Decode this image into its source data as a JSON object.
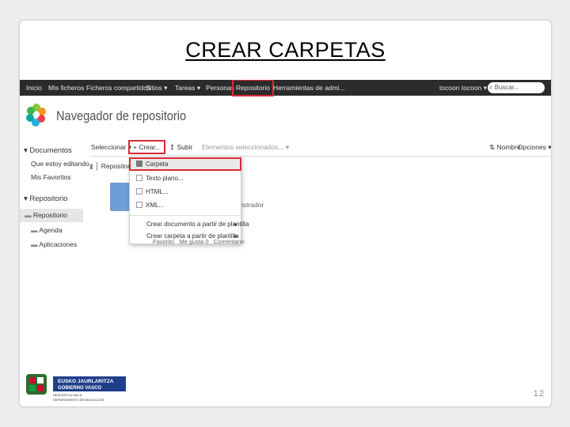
{
  "slide": {
    "title": "CREAR CARPETAS",
    "page_number": "12"
  },
  "topnav": {
    "items": [
      "Inicio",
      "Mis ficheros",
      "Ficheros compartidos",
      "Sitios ▾",
      "Tareas ▾",
      "Personas",
      "Repositorio",
      "Herramientas de admi..."
    ],
    "highlighted": "Repositorio",
    "user": "tocoon tocoon ▾",
    "search_placeholder": "Buscar..."
  },
  "app": {
    "title": "Navegador de repositorio"
  },
  "sidebar": {
    "documents_heading": "▾ Documentos",
    "documents_items": [
      "Que estoy editando",
      "Mis Favoritos"
    ],
    "repo_heading": "▾ Repositorio",
    "repo_items": [
      "Repositorio",
      "Agenda",
      "Aplicaciones"
    ]
  },
  "toolbar": {
    "select": "Seleccionar ▾",
    "create": "+ Crear...",
    "upload": "Subir",
    "selected": "Elementos seleccionados... ▾",
    "sort": "Nombre",
    "options": "Opciones ▾"
  },
  "breadcrumb": {
    "label": "Repositorio"
  },
  "create_menu": {
    "items": [
      "Carpeta",
      "Texto plano...",
      "HTML...",
      "XML..."
    ],
    "submenus": [
      "Crear documento a partir de plantilla",
      "Crear carpeta a partir de plantilla"
    ],
    "highlighted": "Carpeta"
  },
  "folder_meta": {
    "favorite": "Favorito",
    "like": "Me gusta",
    "like_count": "0",
    "comment": "Comentario",
    "owner_fragment": "istrador"
  },
  "footer": {
    "org_line1": "EUSKO JAURLARITZA",
    "org_line2": "GOBIERNO VASCO",
    "dept_line1": "HEZKUNTZA SAILA",
    "dept_line2": "DEPARTAMENTO DE EDUCACIÓN"
  },
  "colors": {
    "highlight": "#d62b36",
    "nav_bg": "#2b2b2b",
    "folder": "#6e9ed6"
  }
}
